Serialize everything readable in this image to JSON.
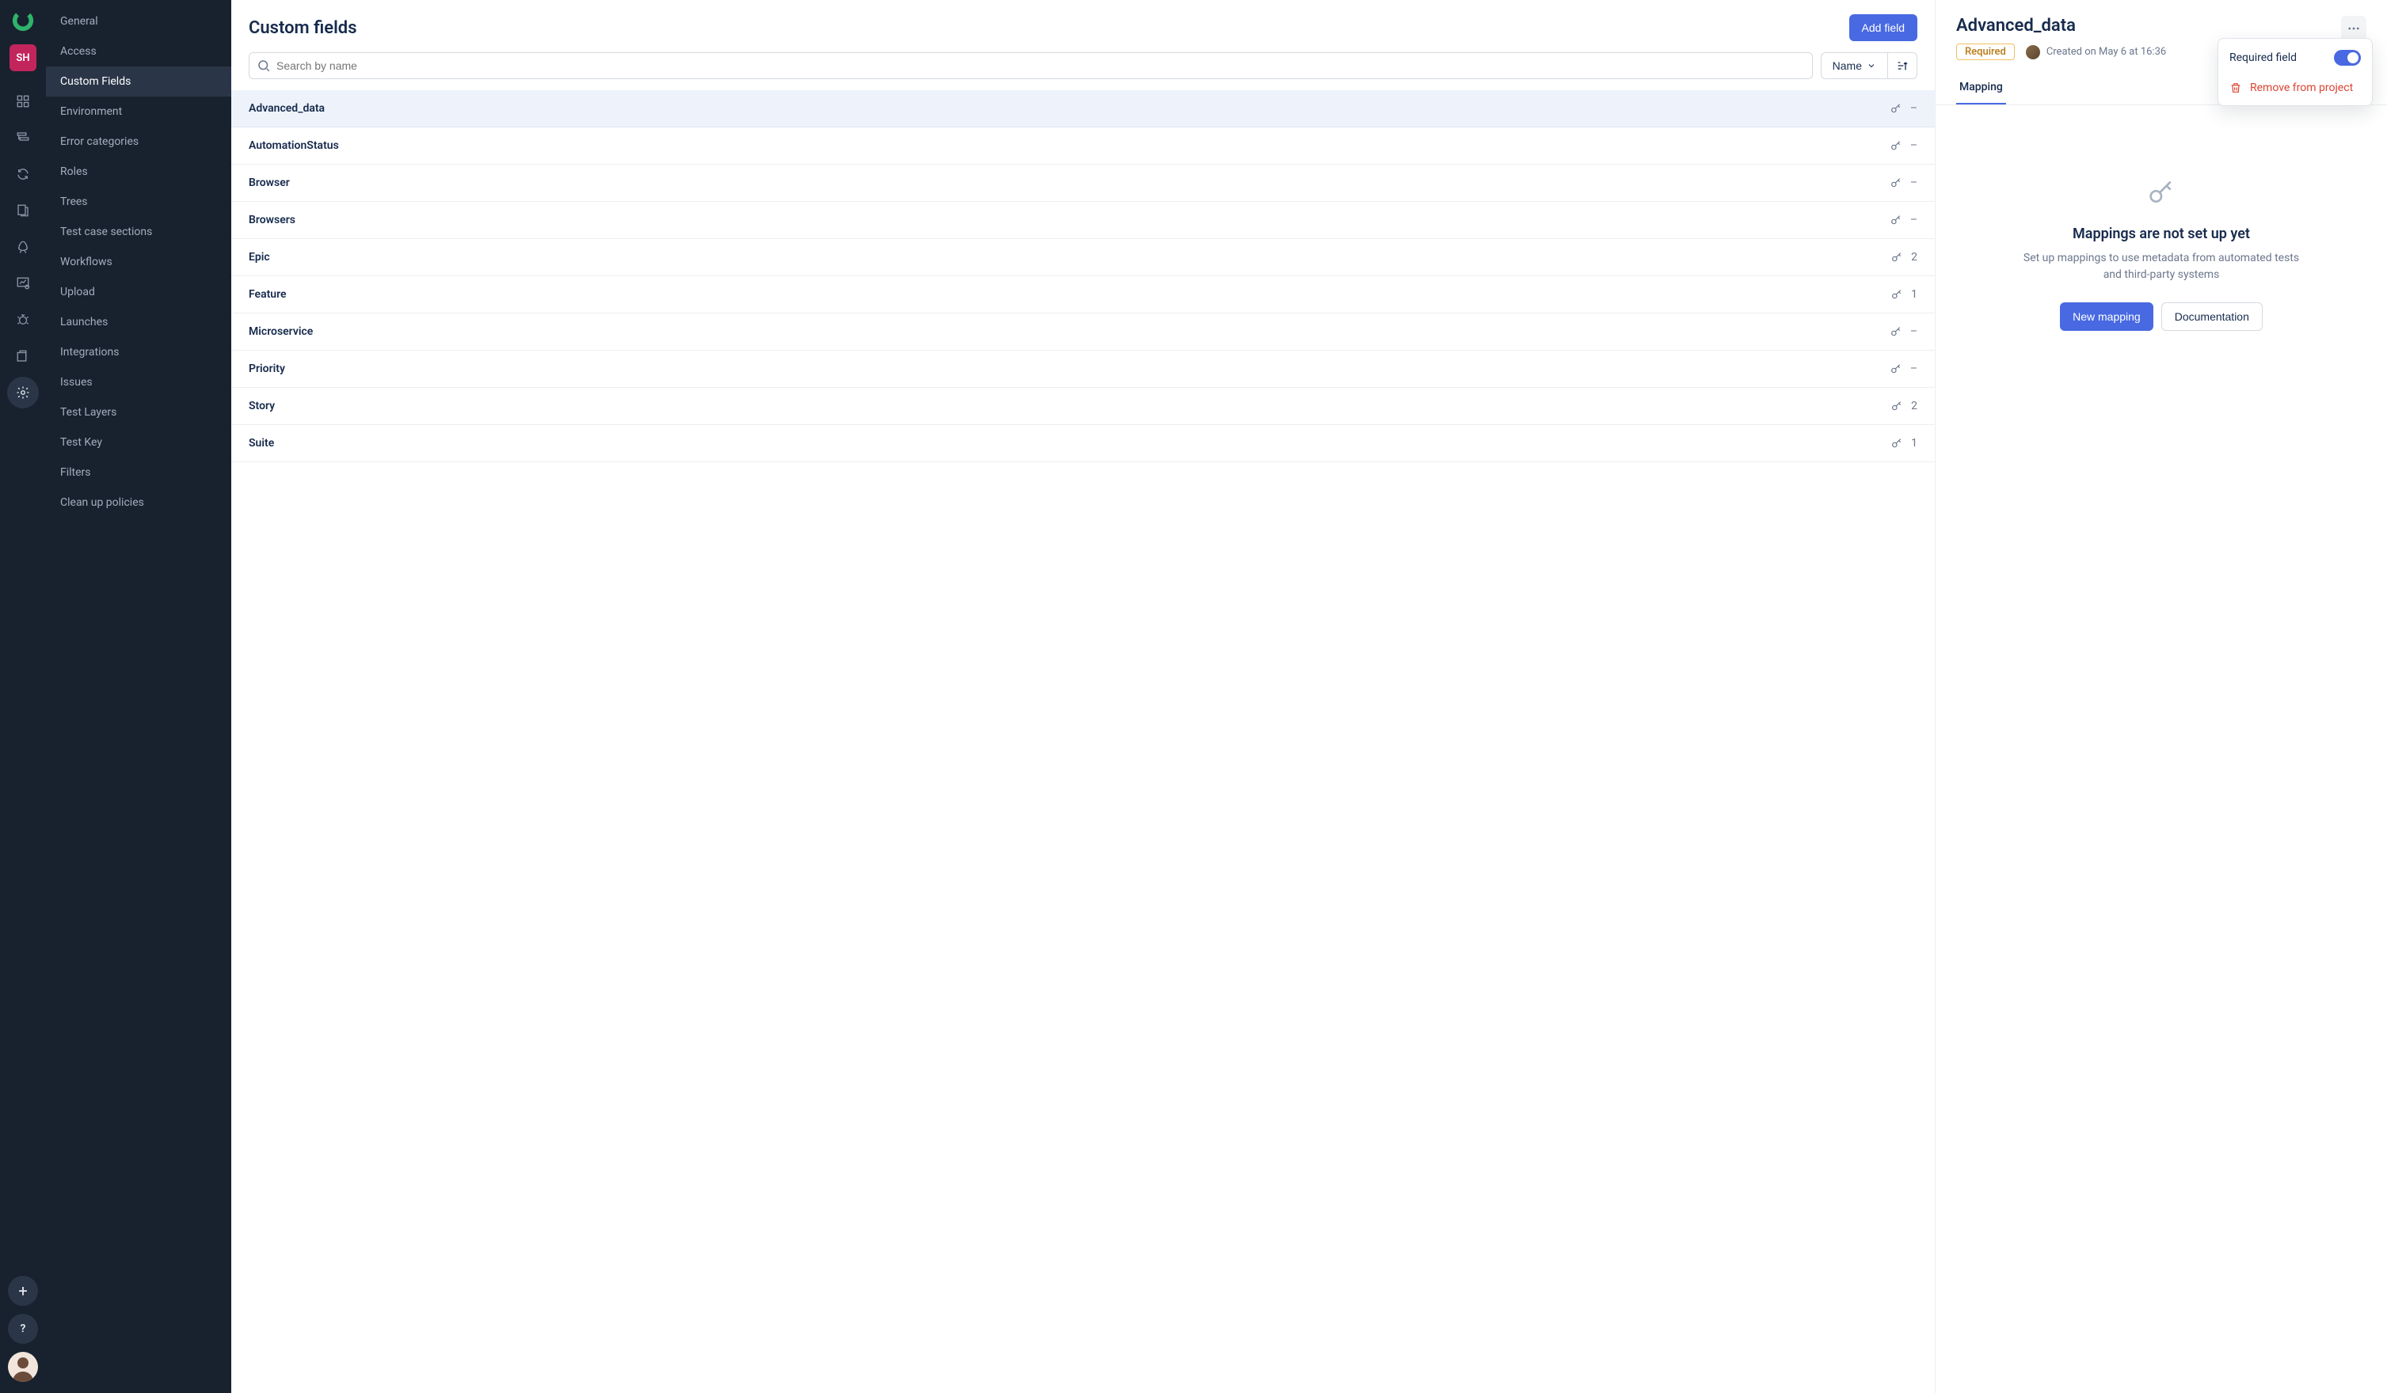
{
  "colors": {
    "accent": "#4869e1",
    "danger": "#d43",
    "warn": "#b87a14"
  },
  "rail": {
    "avatar_initials": "SH"
  },
  "nav": {
    "items": [
      {
        "label": "General"
      },
      {
        "label": "Access"
      },
      {
        "label": "Custom Fields"
      },
      {
        "label": "Environment"
      },
      {
        "label": "Error categories"
      },
      {
        "label": "Roles"
      },
      {
        "label": "Trees"
      },
      {
        "label": "Test case sections"
      },
      {
        "label": "Workflows"
      },
      {
        "label": "Upload"
      },
      {
        "label": "Launches"
      },
      {
        "label": "Integrations"
      },
      {
        "label": "Issues"
      },
      {
        "label": "Test Layers"
      },
      {
        "label": "Test Key"
      },
      {
        "label": "Filters"
      },
      {
        "label": "Clean up policies"
      }
    ],
    "active_index": 2
  },
  "list": {
    "title": "Custom fields",
    "add_button": "Add field",
    "search_placeholder": "Search by name",
    "sort_label": "Name",
    "fields": [
      {
        "name": "Advanced_data",
        "count": "–"
      },
      {
        "name": "AutomationStatus",
        "count": "–"
      },
      {
        "name": "Browser",
        "count": "–"
      },
      {
        "name": "Browsers",
        "count": "–"
      },
      {
        "name": "Epic",
        "count": "2"
      },
      {
        "name": "Feature",
        "count": "1"
      },
      {
        "name": "Microservice",
        "count": "–"
      },
      {
        "name": "Priority",
        "count": "–"
      },
      {
        "name": "Story",
        "count": "2"
      },
      {
        "name": "Suite",
        "count": "1"
      }
    ],
    "selected_index": 0
  },
  "detail": {
    "title": "Advanced_data",
    "required_badge": "Required",
    "created_text": "Created on May 6 at 16:36",
    "tabs": [
      {
        "label": "Mapping"
      }
    ],
    "active_tab": 0,
    "empty": {
      "title": "Mappings are not set up yet",
      "subtitle": "Set up mappings to use metadata from automated tests and third-party systems",
      "primary_btn": "New mapping",
      "secondary_btn": "Documentation"
    },
    "menu": {
      "required_label": "Required field",
      "required_on": true,
      "remove_label": "Remove from project"
    }
  }
}
